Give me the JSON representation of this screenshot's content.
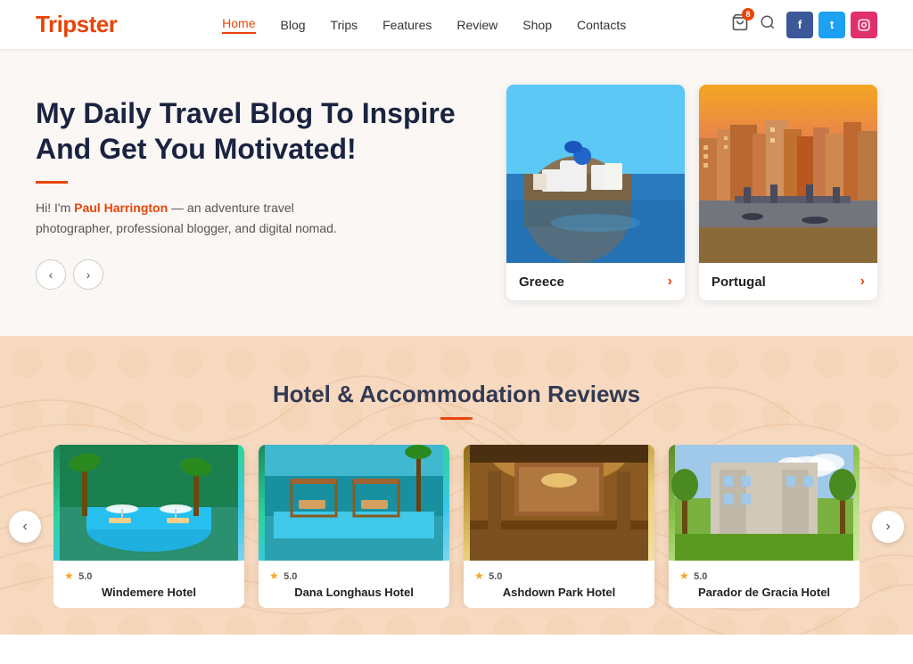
{
  "header": {
    "logo_prefix": "Trip",
    "logo_suffix": "ster",
    "nav_items": [
      {
        "label": "Home",
        "active": true
      },
      {
        "label": "Blog",
        "active": false
      },
      {
        "label": "Trips",
        "active": false
      },
      {
        "label": "Features",
        "active": false
      },
      {
        "label": "Review",
        "active": false
      },
      {
        "label": "Shop",
        "active": false
      },
      {
        "label": "Contacts",
        "active": false
      }
    ],
    "cart_badge": "8",
    "social": [
      {
        "name": "facebook",
        "label": "f"
      },
      {
        "name": "twitter",
        "label": "t"
      },
      {
        "name": "instagram",
        "label": "in"
      }
    ]
  },
  "hero": {
    "title": "My Daily Travel Blog To Inspire And Get You Motivated!",
    "author_name": "Paul Harrington",
    "description_prefix": "Hi! I'm ",
    "description_suffix": " — an adventure travel photographer, professional blogger, and digital nomad.",
    "prev_arrow": "‹",
    "next_arrow": "›",
    "destinations": [
      {
        "name": "Greece",
        "arrow": "›",
        "type": "greece"
      },
      {
        "name": "Portugal",
        "arrow": "›",
        "type": "portugal"
      }
    ]
  },
  "reviews": {
    "section_title": "Hotel & Accommodation Reviews",
    "hotels": [
      {
        "name": "Windemere Hotel",
        "rating": "5.0",
        "stars": "★"
      },
      {
        "name": "Dana Longhaus Hotel",
        "rating": "5.0",
        "stars": "★"
      },
      {
        "name": "Ashdown Park Hotel",
        "rating": "5.0",
        "stars": "★"
      },
      {
        "name": "Parador de Gracia Hotel",
        "rating": "5.0",
        "stars": "★"
      }
    ],
    "prev_arrow": "‹",
    "next_arrow": "›"
  },
  "colors": {
    "accent": "#e8450a",
    "dark": "#1a2340",
    "light_bg": "#faf7f4",
    "peach_bg": "#f5d5b8"
  }
}
